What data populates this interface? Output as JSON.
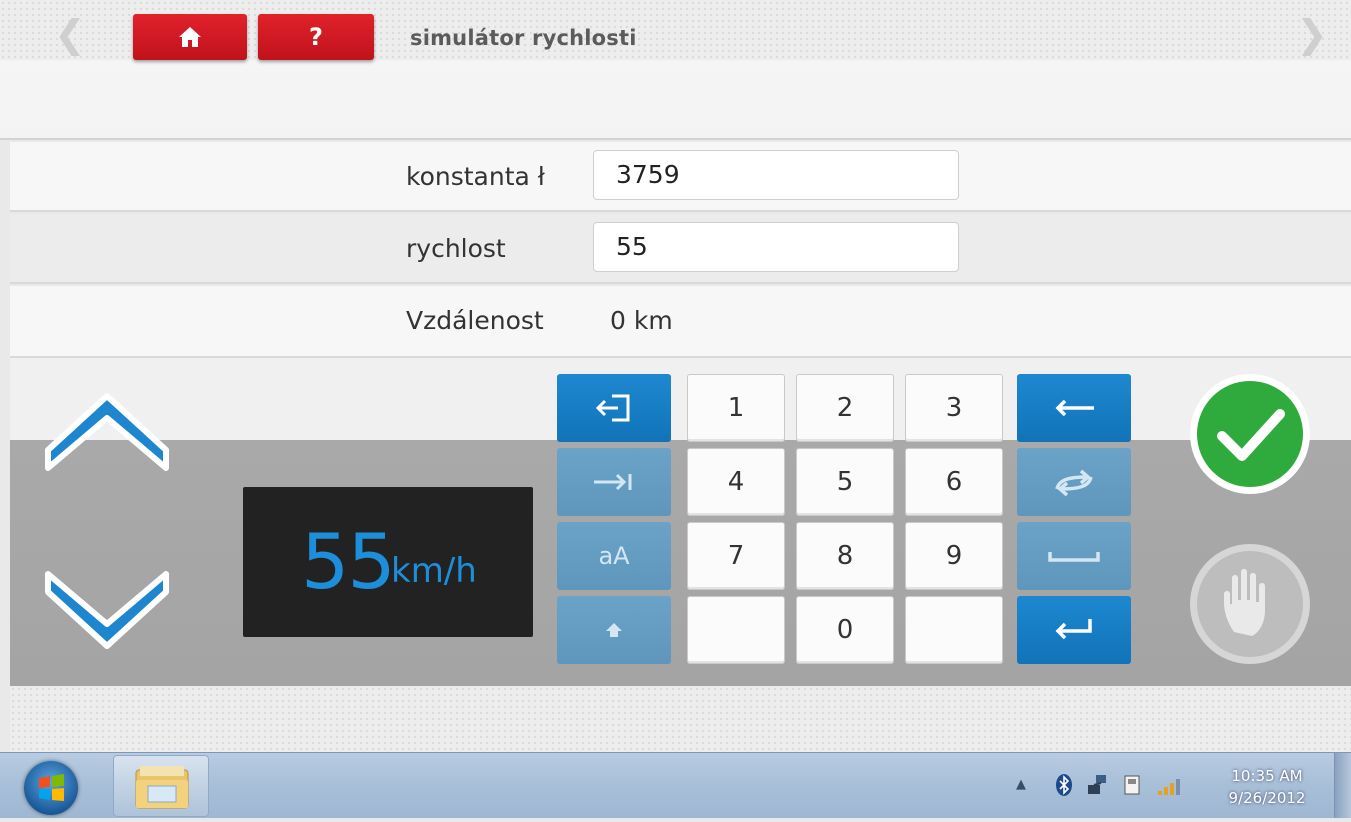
{
  "header": {
    "title": "simulátor rychlosti",
    "help_label": "?",
    "back_icon": "chevron-left-icon",
    "forward_icon": "chevron-right-icon",
    "home_icon": "home-icon"
  },
  "form": {
    "constant_label": "konstanta ł",
    "constant_value": "3759",
    "speed_label": "rychlost",
    "speed_value": "55",
    "distance_label": "Vzdálenost",
    "distance_value": "0 km"
  },
  "display": {
    "speed": "55",
    "unit": "km/h"
  },
  "keypad": {
    "digits": [
      "1",
      "2",
      "3",
      "4",
      "5",
      "6",
      "7",
      "8",
      "9",
      "0"
    ],
    "case_label": "aA",
    "left_keys": [
      "exit-icon",
      "tab-icon",
      "case-toggle",
      "shift-icon"
    ],
    "right_keys": [
      "backspace-icon",
      "swap-icon",
      "space-icon",
      "enter-icon"
    ]
  },
  "taskbar": {
    "time": "10:35 AM",
    "date": "9/26/2012"
  },
  "colors": {
    "accent_blue": "#1a82c8",
    "header_red": "#d0161f",
    "ok_green": "#2eab3c",
    "display_text": "#1d8ed9"
  }
}
